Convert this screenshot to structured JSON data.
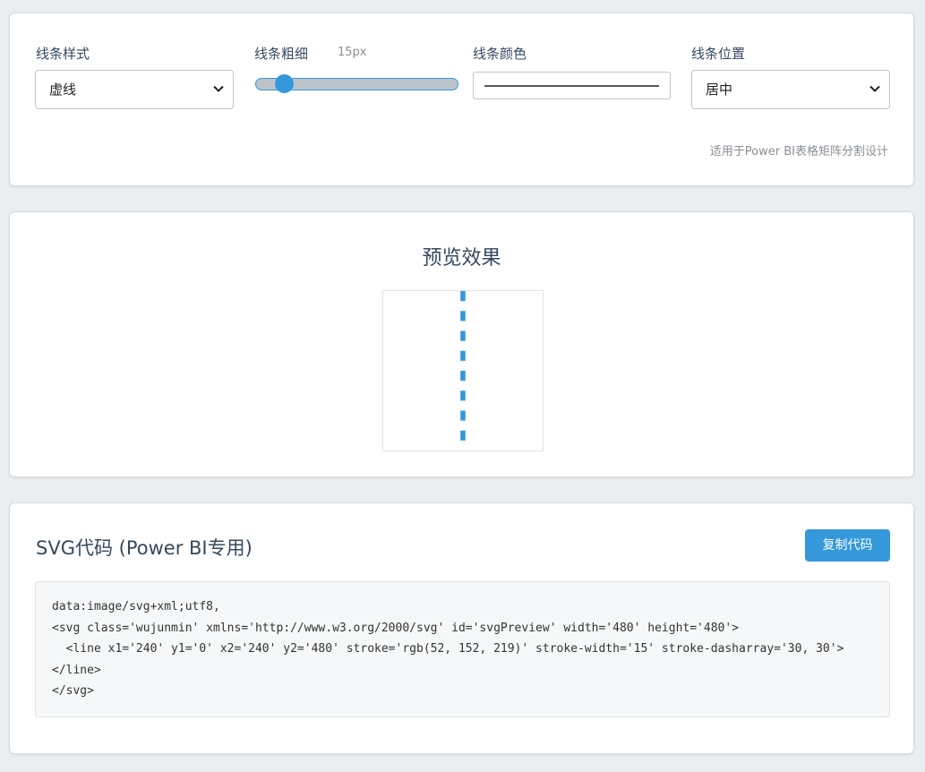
{
  "controls": {
    "line_style": {
      "label": "线条样式",
      "value": "虚线"
    },
    "line_width": {
      "label": "线条粗细",
      "value_text": "15px",
      "value": 15,
      "fraction": 0.08
    },
    "line_color": {
      "label": "线条颜色",
      "value": "#555b61"
    },
    "line_position": {
      "label": "线条位置",
      "value": "居中"
    },
    "footnote": "适用于Power BI表格矩阵分割设计"
  },
  "preview": {
    "title": "预览效果",
    "stroke_color": "#3498db",
    "stroke_width": 15,
    "dasharray": [
      30,
      30
    ]
  },
  "code": {
    "title": "SVG代码 (Power BI专用)",
    "copy_label": "复制代码",
    "lines": [
      "data:image/svg+xml;utf8,",
      "<svg class='wujunmin' xmlns='http://www.w3.org/2000/svg' id='svgPreview' width='480' height='480'>",
      "  <line x1='240' y1='0' x2='240' y2='480' stroke='rgb(52, 152, 219)' stroke-width='15' stroke-dasharray='30, 30'>",
      "</line>",
      "</svg>"
    ]
  },
  "colors": {
    "accent": "#3498db",
    "page_bg": "#ebeef0",
    "text": "#34495e"
  }
}
